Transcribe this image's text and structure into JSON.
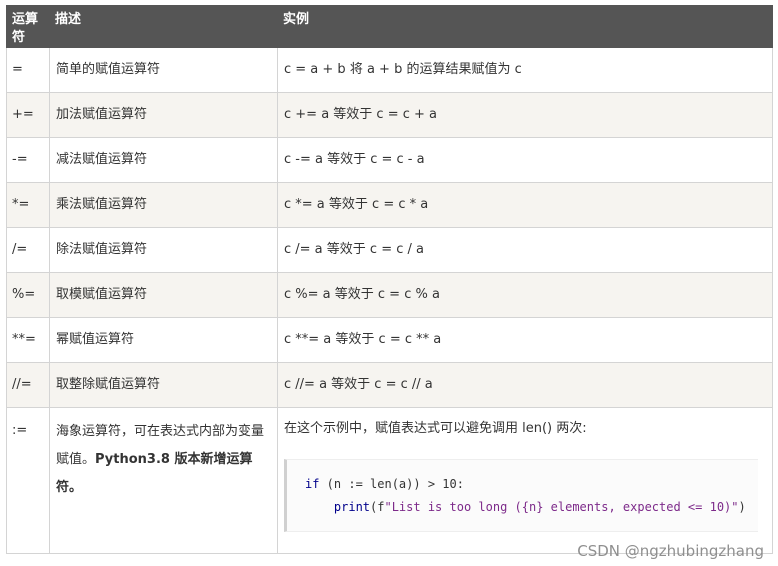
{
  "table": {
    "headers": [
      "运算符",
      "描述",
      "实例"
    ],
    "rows": [
      {
        "op": "=",
        "desc": "简单的赋值运算符",
        "example": "c = a + b 将 a + b 的运算结果赋值为 c"
      },
      {
        "op": "+=",
        "desc": "加法赋值运算符",
        "example": "c += a 等效于 c = c + a"
      },
      {
        "op": "-=",
        "desc": "减法赋值运算符",
        "example": "c -= a 等效于 c = c - a"
      },
      {
        "op": "*=",
        "desc": "乘法赋值运算符",
        "example": "c *= a 等效于 c = c * a"
      },
      {
        "op": "/=",
        "desc": "除法赋值运算符",
        "example": "c /= a 等效于 c = c / a"
      },
      {
        "op": "%=",
        "desc": "取模赋值运算符",
        "example": "c %= a 等效于 c = c % a"
      },
      {
        "op": "**=",
        "desc": "幂赋值运算符",
        "example": "c **= a 等效于 c = c ** a"
      },
      {
        "op": "//=",
        "desc": "取整除赋值运算符",
        "example": "c //= a 等效于 c = c // a"
      }
    ],
    "last_row": {
      "op": ":=",
      "desc_plain": "海象运算符，可在表达式内部为变量赋值。",
      "desc_bold": "Python3.8 版本新增运算符。",
      "example_text": "在这个示例中，赋值表达式可以避免调用 len() 两次:",
      "code": {
        "line1_kw": "if",
        "line1_rest": " (n := len(a)) > 10:",
        "line2_indent": "    ",
        "line2_fn": "print",
        "line2_open": "(f",
        "line2_str": "\"List is too long ({n} elements, expected <= 10)\"",
        "line2_close": ")"
      }
    }
  },
  "watermark": "CSDN @ngzhubingzhang"
}
